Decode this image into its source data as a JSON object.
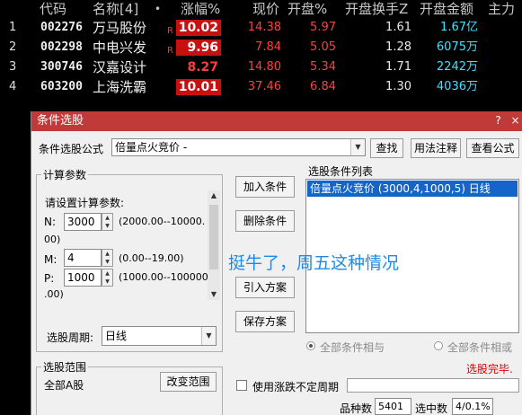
{
  "table": {
    "headers": [
      "代码",
      "名称[4]",
      "•",
      "涨幅%",
      "现价",
      "开盘%",
      "开盘换手Z",
      "开盘金额",
      "主力"
    ],
    "rows": [
      {
        "idx": "1",
        "code": "002276",
        "name": "万马股份",
        "flag": "R",
        "chg": "10.02",
        "price": "14.38",
        "open": "5.97",
        "turnover": "1.61",
        "amount": "1.67亿",
        "highlight": true
      },
      {
        "idx": "2",
        "code": "002298",
        "name": "中电兴发",
        "flag": "R",
        "chg": "9.96",
        "price": "7.84",
        "open": "5.05",
        "turnover": "1.28",
        "amount": "6075万",
        "highlight": true
      },
      {
        "idx": "3",
        "code": "300746",
        "name": "汉嘉设计",
        "flag": "",
        "chg": "8.27",
        "price": "14.80",
        "open": "5.34",
        "turnover": "1.71",
        "amount": "2242万",
        "highlight": false
      },
      {
        "idx": "4",
        "code": "603200",
        "name": "上海洗霸",
        "flag": "",
        "chg": "10.01",
        "price": "37.46",
        "open": "6.84",
        "turnover": "1.30",
        "amount": "4036万",
        "highlight": true
      }
    ]
  },
  "dialog": {
    "title": "条件选股",
    "help_btn": "?",
    "close_btn": "×",
    "formula_label": "条件选股公式",
    "formula_value": "倍量点火竞价  -",
    "btn_find": "查找",
    "btn_usage": "用法注释",
    "btn_view": "查看公式",
    "params_title": "计算参数",
    "params_prompt": "请设置计算参数:",
    "params": [
      {
        "name": "N:",
        "value": "3000",
        "range1": "(2000.00--10000.",
        "range2": "00)"
      },
      {
        "name": "M:",
        "value": "4",
        "range1": "(0.00--19.00)",
        "range2": ""
      },
      {
        "name": "P:",
        "value": "1000",
        "range1": "(1000.00--100000",
        "range2": ".00)"
      }
    ],
    "period_label": "选股周期:",
    "period_value": "日线",
    "btn_add": "加入条件",
    "btn_delete": "删除条件",
    "btn_import": "引入方案",
    "btn_save": "保存方案",
    "list_title": "选股条件列表",
    "list_items": [
      "倍量点火竞价 (3000,4,1000,5) 日线"
    ],
    "radio_and": "全部条件相与",
    "radio_or": "全部条件相或",
    "status": "选股完毕.",
    "scope_title": "选股范围",
    "scope_value": "全部A股",
    "btn_change_scope": "改变范围",
    "chk_period": "使用涨跌不定周期",
    "count_label": "品种数",
    "count_value": "5401",
    "selected_label": "选中数",
    "selected_value": "4/0.1%",
    "status_color": "#e00000"
  },
  "overlay_text": "挺牛了，周五这种情况"
}
